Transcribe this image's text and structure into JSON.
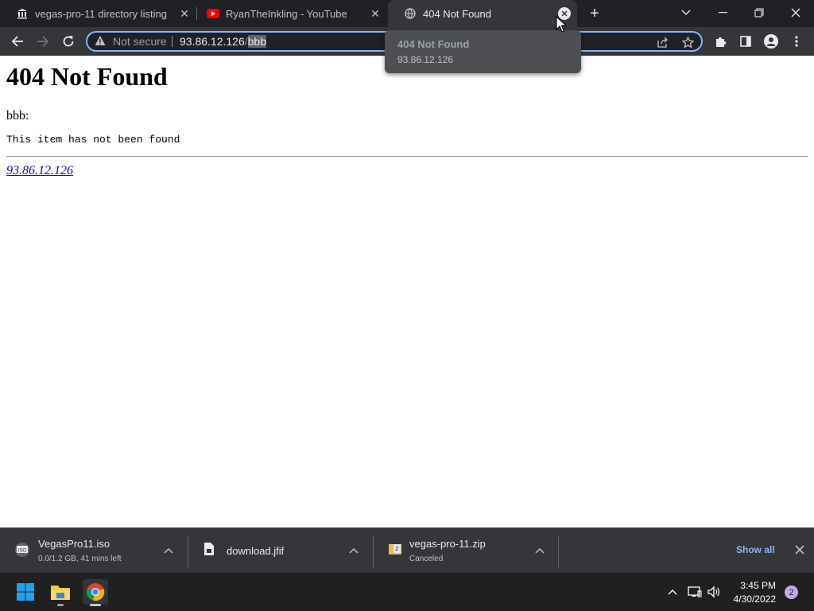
{
  "browser": {
    "tabs": [
      {
        "title": "vegas-pro-11 directory listing",
        "icon": "archive-icon",
        "active": false
      },
      {
        "title": "RyanTheInkling - YouTube",
        "icon": "youtube-icon",
        "active": false
      },
      {
        "title": "404 Not Found",
        "icon": "globe-icon",
        "active": true
      }
    ],
    "omnibox": {
      "security_text": "Not secure",
      "host": "93.86.12.126",
      "separator": "/",
      "path": "bbb"
    },
    "tooltip": {
      "title": "404 Not Found",
      "url": "93.86.12.126"
    }
  },
  "page": {
    "heading": "404 Not Found",
    "label": "bbb:",
    "message": "This item has not been found",
    "link": "93.86.12.126"
  },
  "downloads": {
    "items": [
      {
        "name": "VegasPro11.iso",
        "status": "0.0/1.2 GB, 41 mins left",
        "icon": "iso-file-icon"
      },
      {
        "name": "download.jfif",
        "status": "",
        "icon": "image-file-icon"
      },
      {
        "name": "vegas-pro-11.zip",
        "status": "Canceled",
        "icon": "zip-file-icon"
      }
    ],
    "show_all": "Show all"
  },
  "taskbar": {
    "time": "3:45 PM",
    "date": "4/30/2022",
    "notifications": "2"
  }
}
